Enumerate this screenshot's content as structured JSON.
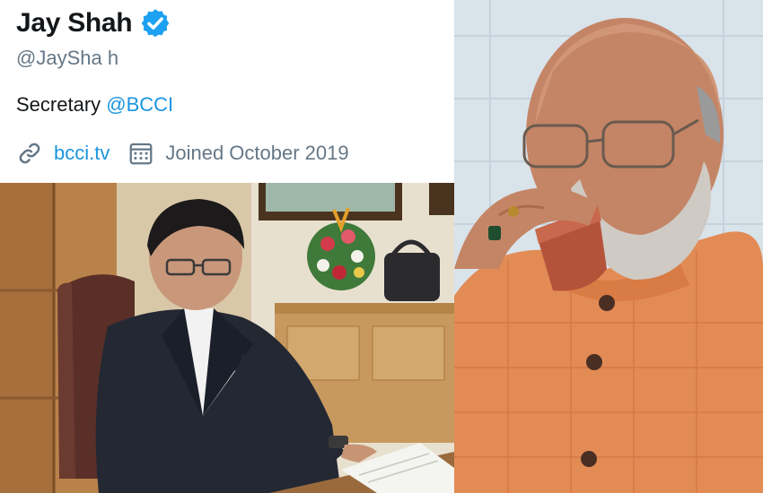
{
  "profile": {
    "name": "Jay Shah",
    "handle": "@JaySha h",
    "bio_prefix": "Secretary ",
    "bio_mention": "@BCCI",
    "website": "bcci.tv",
    "joined": "Joined October 2019"
  },
  "icons": {
    "verified": "verified-badge-icon",
    "link": "link-icon",
    "calendar": "calendar-icon"
  },
  "colors": {
    "link_blue": "#1b95e0",
    "name_text": "#14171a",
    "muted_text": "#657786",
    "verified_blue": "#1da1f2"
  }
}
